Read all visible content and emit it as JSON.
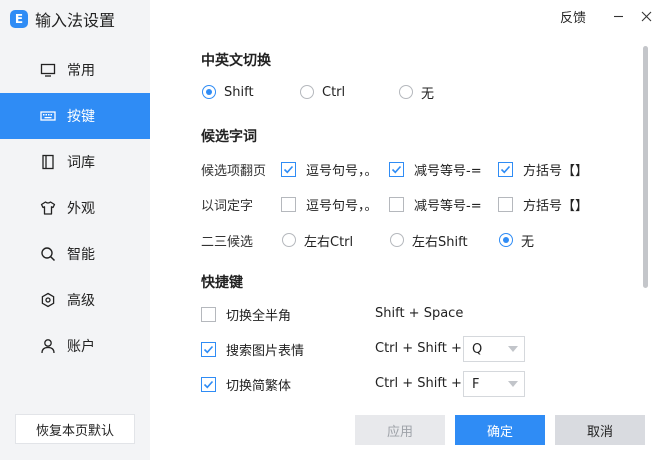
{
  "app": {
    "title": "输入法设置",
    "logo_glyph": "E",
    "accent": "#2f8cf5"
  },
  "topbar": {
    "feedback": "反馈"
  },
  "sidebar": {
    "items": [
      {
        "label": "常用",
        "icon": "monitor-icon",
        "active": false
      },
      {
        "label": "按键",
        "icon": "keyboard-icon",
        "active": true
      },
      {
        "label": "词库",
        "icon": "book-icon",
        "active": false
      },
      {
        "label": "外观",
        "icon": "shirt-icon",
        "active": false
      },
      {
        "label": "智能",
        "icon": "search-icon",
        "active": false
      },
      {
        "label": "高级",
        "icon": "hexagon-icon",
        "active": false
      },
      {
        "label": "账户",
        "icon": "user-icon",
        "active": false
      }
    ],
    "restore_label": "恢复本页默认"
  },
  "section_switch": {
    "title": "中英文切换",
    "options": [
      {
        "label": "Shift",
        "selected": true
      },
      {
        "label": "Ctrl",
        "selected": false
      },
      {
        "label": "无",
        "selected": false
      }
    ]
  },
  "section_candidates": {
    "title": "候选字词",
    "page_turn": {
      "label": "候选项翻页",
      "options": [
        {
          "label": "逗号句号，。",
          "checked": true
        },
        {
          "label": "减号等号-=",
          "checked": true
        },
        {
          "label": "方括号【】",
          "checked": true
        }
      ]
    },
    "word_select": {
      "label": "以词定字",
      "options": [
        {
          "label": "逗号句号，。",
          "checked": false
        },
        {
          "label": "减号等号-=",
          "checked": false
        },
        {
          "label": "方括号【】",
          "checked": false
        }
      ]
    },
    "second_third": {
      "label": "二三候选",
      "options": [
        {
          "label": "左右Ctrl",
          "selected": false
        },
        {
          "label": "左右Shift",
          "selected": false
        },
        {
          "label": "无",
          "selected": true
        }
      ]
    }
  },
  "section_shortcuts": {
    "title": "快捷键",
    "rows": [
      {
        "label": "切换全半角",
        "checked": false,
        "combo": "Shift + Space",
        "key": ""
      },
      {
        "label": "搜索图片表情",
        "checked": true,
        "combo": "Ctrl + Shift +",
        "key": "Q"
      },
      {
        "label": "切换简繁体",
        "checked": true,
        "combo": "Ctrl + Shift +",
        "key": "F"
      }
    ]
  },
  "footer": {
    "apply": "应用",
    "ok": "确定",
    "cancel": "取消"
  }
}
